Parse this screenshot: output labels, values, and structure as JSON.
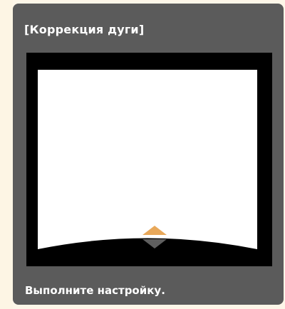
{
  "dialog": {
    "title": "[Коррекция дуги]",
    "status": "Выполните настройку."
  },
  "preview": {
    "icons": [
      "up-arrow-icon",
      "down-arrow-icon"
    ],
    "colors": {
      "background": "#000000",
      "screen": "#ffffff",
      "arrow_up": "#e8a85a",
      "arrow_down": "#5f5f5f"
    }
  }
}
